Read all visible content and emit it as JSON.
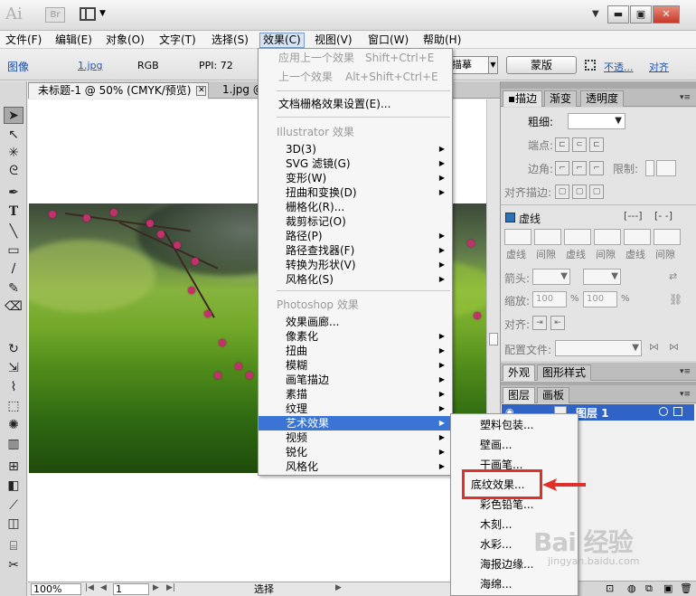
{
  "titlebar": {
    "app_logo": "Ai",
    "bridge_label": "Br",
    "dropdown_glyph": "▼",
    "minimize": "▬",
    "restore": "▣",
    "close": "✕"
  },
  "menubar": {
    "items": [
      "文件(F)",
      "编辑(E)",
      "对象(O)",
      "文字(T)",
      "选择(S)",
      "效果(C)",
      "视图(V)",
      "窗口(W)",
      "帮助(H)"
    ]
  },
  "control_bar": {
    "type": "图像",
    "filename": "1.jpg",
    "mode": "RGB",
    "ppi": "PPI: 72",
    "trace_label": "描摹",
    "mask_label": "蒙版",
    "opacity_label": "不透...",
    "align_label": "对齐"
  },
  "doc_tabs": [
    {
      "title": "未标题-1 @ 50% (CMYK/预览)"
    },
    {
      "title": "1.jpg @ ..."
    }
  ],
  "status_bar": {
    "zoom": "100%",
    "page": "1",
    "tool": "选择"
  },
  "effect_menu": {
    "apply_last": {
      "label": "应用上一个效果",
      "shortcut": "Shift+Ctrl+E"
    },
    "last_effect": {
      "label": "上一个效果",
      "shortcut": "Alt+Shift+Ctrl+E"
    },
    "doc_raster": "文档栅格效果设置(E)...",
    "illustrator_group": "Illustrator 效果",
    "illustrator_items": [
      "3D(3)",
      "SVG 滤镜(G)",
      "变形(W)",
      "扭曲和变换(D)",
      "栅格化(R)...",
      "裁剪标记(O)",
      "路径(P)",
      "路径查找器(F)",
      "转换为形状(V)",
      "风格化(S)"
    ],
    "photoshop_group": "Photoshop 效果",
    "photoshop_items": [
      "效果画廊...",
      "像素化",
      "扭曲",
      "模糊",
      "画笔描边",
      "素描",
      "纹理",
      "艺术效果",
      "视频",
      "锐化",
      "风格化"
    ]
  },
  "artistic_submenu": {
    "items": [
      "塑料包装...",
      "壁画...",
      "干画笔...",
      "底纹效果...",
      "彩色铅笔...",
      "木刻...",
      "水彩...",
      "海报边缘...",
      "海绵..."
    ]
  },
  "stroke_panel": {
    "tabs": [
      "描边",
      "渐变",
      "透明度"
    ],
    "weight_label": "粗细:",
    "cap_label": "端点:",
    "corner_label": "边角:",
    "limit_label": "限制:",
    "align_label": "对齐描边:",
    "dashed_label": "虚线",
    "dash_labels": [
      "虚线",
      "间隙",
      "虚线",
      "间隙",
      "虚线",
      "间隙"
    ],
    "arrow_label": "箭头:",
    "scale_label": "缩放:",
    "scale_value1": "100",
    "scale_value2": "100",
    "percent": "%",
    "align2_label": "对齐:",
    "profile_label": "配置文件:"
  },
  "appearance_panel": {
    "tabs": [
      "外观",
      "图形样式"
    ]
  },
  "layers_panel": {
    "tabs": [
      "图层",
      "画板"
    ],
    "layer_name": "图层 1"
  },
  "watermark": {
    "big": "Bai 经验",
    "small": "jingyan.baidu.com"
  },
  "colors": {
    "highlight": "#3a75d6",
    "red_box": "#e0302a",
    "layer_row": "#2f63c6"
  }
}
